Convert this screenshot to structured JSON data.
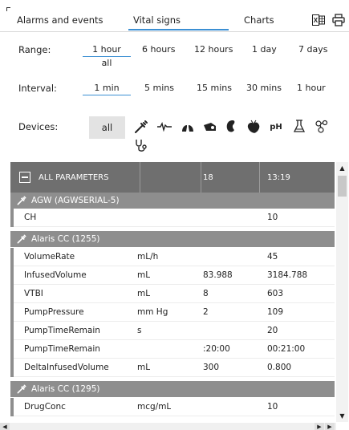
{
  "tabs": [
    {
      "label": "Alarms and events"
    },
    {
      "label": "Vital signs"
    },
    {
      "label": "Charts"
    }
  ],
  "toolbar": {
    "export_icon": "excel-export-icon",
    "print_icon": "print-icon"
  },
  "range": {
    "label": "Range:",
    "options": [
      "1 hour",
      "6 hours",
      "12 hours",
      "1 day",
      "7 days"
    ],
    "options_second_line": "all",
    "selected": "1 hour"
  },
  "interval": {
    "label": "Interval:",
    "options": [
      "1 min",
      "5 mins",
      "15 mins",
      "30 mins",
      "1 hour"
    ],
    "selected": "1 min"
  },
  "devices": {
    "label": "Devices:",
    "all_label": "all",
    "icons": [
      "syringe-icon",
      "ecg-wave-icon",
      "lungs-icon",
      "infusion-pump-icon",
      "kidney-icon",
      "heart-icon",
      "ph-icon",
      "flask-icon",
      "molecule-icon",
      "stethoscope-icon"
    ],
    "ph_text": "pH"
  },
  "grid": {
    "header": {
      "all_parameters": "ALL PARAMETERS",
      "time_col_1": "18",
      "time_col_2": "13:19"
    },
    "groups": [
      {
        "name": "AGW (AGWSERIAL-5)",
        "rows": [
          {
            "param": "CH",
            "unit": "",
            "v1": "",
            "v2": "10"
          }
        ]
      },
      {
        "name": "Alaris CC (1255)",
        "rows": [
          {
            "param": "VolumeRate",
            "unit": "mL/h",
            "v1": "",
            "v2": "45"
          },
          {
            "param": "InfusedVolume",
            "unit": "mL",
            "v1": "83.988",
            "v2": "3184.788"
          },
          {
            "param": "VTBI",
            "unit": "mL",
            "v1": "8",
            "v2": "603"
          },
          {
            "param": "PumpPressure",
            "unit": "mm Hg",
            "v1": "2",
            "v2": "109"
          },
          {
            "param": "PumpTimeRemain",
            "unit": "s",
            "v1": "",
            "v2": "20"
          },
          {
            "param": "PumpTimeRemain",
            "unit": "",
            "v1": ":20:00",
            "v2": "00:21:00"
          },
          {
            "param": "DeltaInfusedVolume",
            "unit": "mL",
            "v1": "300",
            "v2": "0.800"
          }
        ]
      },
      {
        "name": "Alaris CC (1295)",
        "rows": [
          {
            "param": "DrugConc",
            "unit": "mcg/mL",
            "v1": "",
            "v2": "10"
          }
        ]
      }
    ]
  },
  "colors": {
    "accent": "#3b8fd3",
    "header_bg": "#6f6f6f",
    "group_bg": "#8e8e8e"
  }
}
